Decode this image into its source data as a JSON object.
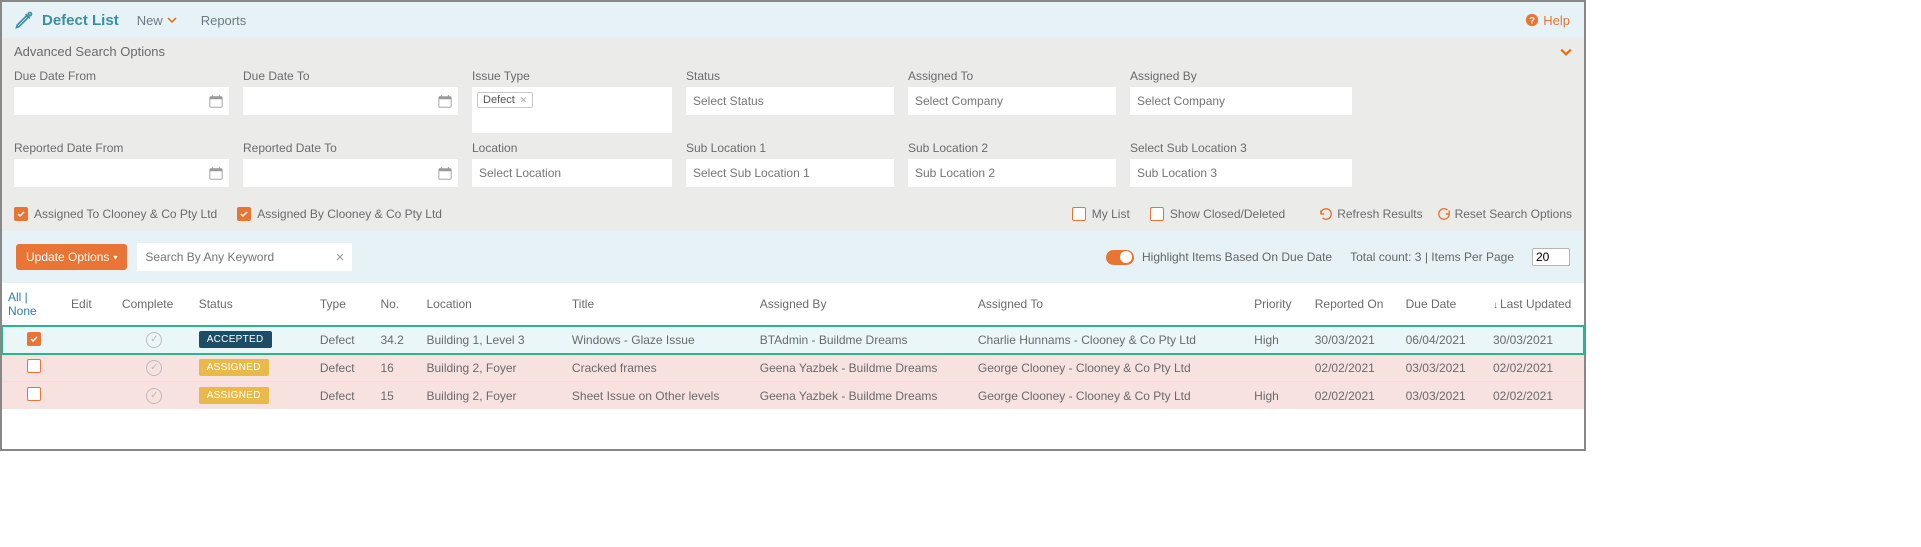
{
  "header": {
    "title": "Defect List",
    "new_label": "New",
    "reports_label": "Reports",
    "help_label": "Help"
  },
  "search": {
    "title": "Advanced Search Options",
    "fields": {
      "due_from": "Due Date From",
      "due_to": "Due Date To",
      "issue_type": "Issue Type",
      "issue_type_tag": "Defect",
      "status": "Status",
      "status_ph": "Select Status",
      "assigned_to": "Assigned To",
      "assigned_by": "Assigned By",
      "select_company_ph": "Select Company",
      "reported_from": "Reported Date From",
      "reported_to": "Reported Date To",
      "location": "Location",
      "location_ph": "Select Location",
      "sub1": "Sub Location 1",
      "sub1_ph": "Select Sub Location 1",
      "sub2": "Sub Location 2",
      "sub2_ph": "Sub Location 2",
      "sub3": "Select Sub Location 3",
      "sub3_ph": "Sub Location 3"
    },
    "checks": {
      "assigned_to_me": "Assigned To Clooney & Co Pty Ltd",
      "assigned_by_me": "Assigned By Clooney & Co Pty Ltd",
      "my_list": "My List",
      "show_closed": "Show Closed/Deleted"
    },
    "refresh": "Refresh Results",
    "reset": "Reset Search Options"
  },
  "toolbar": {
    "update_btn": "Update Options",
    "search_ph": "Search By Any Keyword",
    "highlight_label": "Highlight Items Based On Due Date",
    "total_count": "Total count: 3",
    "items_per_page": "Items Per Page",
    "page_size": "20"
  },
  "table": {
    "headers": {
      "all_none": "All | None",
      "edit": "Edit",
      "complete": "Complete",
      "status": "Status",
      "type": "Type",
      "no": "No.",
      "location": "Location",
      "title": "Title",
      "assigned_by": "Assigned By",
      "assigned_to": "Assigned To",
      "priority": "Priority",
      "reported_on": "Reported On",
      "due_date": "Due Date",
      "last_updated": "Last Updated"
    },
    "rows": [
      {
        "checked": true,
        "selected": true,
        "status": "ACCEPTED",
        "status_class": "status-accepted",
        "type": "Defect",
        "no": "34.2",
        "location": "Building 1, Level 3",
        "title": "Windows - Glaze Issue",
        "assigned_by": "BTAdmin - Buildme Dreams",
        "assigned_to": "Charlie Hunnams - Clooney & Co Pty Ltd",
        "priority": "High",
        "reported_on": "30/03/2021",
        "due_date": "06/04/2021",
        "last_updated": "30/03/2021"
      },
      {
        "checked": false,
        "due": true,
        "status": "ASSIGNED",
        "status_class": "status-assigned",
        "type": "Defect",
        "no": "16",
        "location": "Building 2, Foyer",
        "title": "Cracked frames",
        "assigned_by": "Geena Yazbek - Buildme Dreams",
        "assigned_to": "George Clooney - Clooney & Co Pty Ltd",
        "priority": "",
        "reported_on": "02/02/2021",
        "due_date": "03/03/2021",
        "last_updated": "02/02/2021"
      },
      {
        "checked": false,
        "due": true,
        "status": "ASSIGNED",
        "status_class": "status-assigned",
        "type": "Defect",
        "no": "15",
        "location": "Building 2, Foyer",
        "title": "Sheet Issue on Other levels",
        "assigned_by": "Geena Yazbek - Buildme Dreams",
        "assigned_to": "George Clooney - Clooney & Co Pty Ltd",
        "priority": "High",
        "reported_on": "02/02/2021",
        "due_date": "03/03/2021",
        "last_updated": "02/02/2021"
      }
    ]
  }
}
